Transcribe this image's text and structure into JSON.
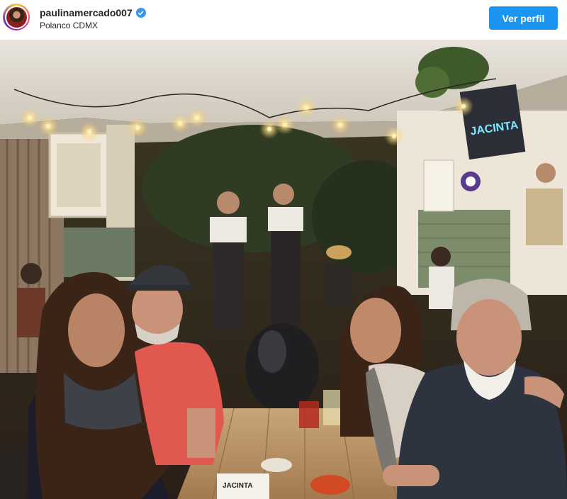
{
  "post": {
    "username": "paulinamercado007",
    "verified": true,
    "location": "Polanco CDMX",
    "profile_button_label": "Ver perfil",
    "colors": {
      "button": "#1a95f2",
      "verified_badge": "#3897f0",
      "text": "#262626"
    },
    "icons": [
      "avatar",
      "verified-badge-icon"
    ]
  },
  "photo": {
    "neon_sign_text": "JACINTA",
    "table_card_text": "JACINTA"
  }
}
